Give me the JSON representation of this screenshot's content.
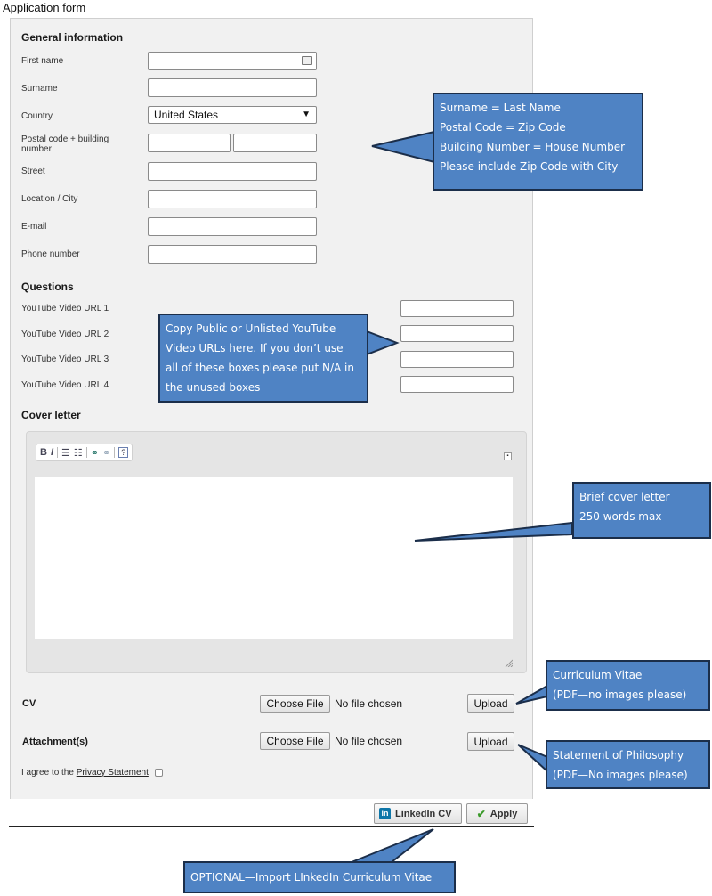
{
  "page": {
    "title": "Application form"
  },
  "general": {
    "heading": "General information",
    "first_name_label": "First name",
    "surname_label": "Surname",
    "country_label": "Country",
    "country_value": "United States",
    "postal_label": "Postal code + building number",
    "street_label": "Street",
    "city_label": "Location / City",
    "email_label": "E-mail",
    "phone_label": "Phone number"
  },
  "questions": {
    "heading": "Questions",
    "url1_label": "YouTube Video URL 1",
    "url2_label": "YouTube Video URL 2",
    "url3_label": "YouTube Video URL 3",
    "url4_label": "YouTube Video URL 4"
  },
  "cover": {
    "heading": "Cover letter",
    "toolbar": {
      "bold": "B",
      "italic": "I",
      "help": "?"
    }
  },
  "cv": {
    "label": "CV",
    "choose": "Choose File",
    "status": "No file chosen",
    "upload": "Upload"
  },
  "attachment": {
    "label": "Attachment(s)",
    "choose": "Choose File",
    "status": "No file chosen",
    "upload": "Upload"
  },
  "privacy": {
    "prefix": "I agree to the ",
    "link": "Privacy Statement"
  },
  "footer": {
    "linkedin": "LinkedIn CV",
    "apply": "Apply"
  },
  "callouts": {
    "names": [
      "Surname = Last Name",
      "Postal Code = Zip Code",
      "Building Number = House Number",
      "Please include Zip Code with City"
    ],
    "youtube": [
      "Copy Public or Unlisted YouTube",
      "Video URLs here.  If you don’t use",
      "all of these boxes please put N/A in",
      "the unused boxes"
    ],
    "cover": [
      "Brief cover letter",
      "250 words max"
    ],
    "cv": [
      "Curriculum Vitae",
      "(PDF—no images please)"
    ],
    "philosophy": [
      "Statement of Philosophy",
      "(PDF—No images please)"
    ],
    "linkedin": "OPTIONAL—Import LInkedIn Curriculum Vitae"
  },
  "colors": {
    "callout_fill": "#4f83c4",
    "callout_border": "#1b2e4a",
    "panel": "#f1f1f1"
  }
}
